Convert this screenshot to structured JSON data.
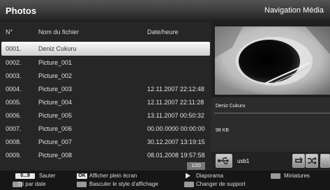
{
  "header": {
    "title": "Photos",
    "right_label": "Navigation Média"
  },
  "list": {
    "columns": {
      "number": "N°",
      "filename": "Nom du fichier",
      "datetime": "Date/heure"
    },
    "rows": [
      {
        "number": "0001.",
        "name": "Deniz Cukuru",
        "date": "",
        "selected": true
      },
      {
        "number": "0002.",
        "name": "Picture_001",
        "date": ""
      },
      {
        "number": "0003.",
        "name": "Picture_002",
        "date": ""
      },
      {
        "number": "0004.",
        "name": "Picture_003",
        "date": "12.11.2007 22:12:48"
      },
      {
        "number": "0005.",
        "name": "Picture_004",
        "date": "12.11.2007 22:11:28"
      },
      {
        "number": "0006.",
        "name": "Picture_005",
        "date": "13.11.2007 00:50:32"
      },
      {
        "number": "0007.",
        "name": "Picture_006",
        "date": "00.00.0000 00:00:00"
      },
      {
        "number": "0008.",
        "name": "Picture_007",
        "date": "30.12.2007 13:19:15"
      },
      {
        "number": "0009.",
        "name": "Picture_008",
        "date": "08.01.2008 19:57:58"
      }
    ],
    "page": "1/20"
  },
  "preview": {
    "image_icon": "photo-thumbnail-icon",
    "file_name": "Deniz Cukuru",
    "file_size": "98 KB",
    "source_label": "usb1",
    "source_icon": "usb-icon",
    "repeat_icon": "repeat-icon",
    "shuffle_icon": "shuffle-icon"
  },
  "footer": {
    "keys": {
      "jump_key": "0...9",
      "jump_label": "Sauter",
      "ok_key": "OK",
      "ok_label": "Afficher plein écran",
      "play_label": "Diaporama",
      "thumbs_label": "Miniatures",
      "sort_label": "Tri par date",
      "style_label": "Basculer le style d'affichage",
      "source_label": "Changer de support"
    },
    "colors": {
      "red": "#c0392b",
      "yellow": "#d7c94a",
      "blue": "#2a5db0",
      "green": "#3b9a3b",
      "white_key": "#e8e8e8"
    }
  },
  "colors": {
    "selected_row": "#e8e8e8",
    "background": "#262626",
    "header": "#3d3d3d"
  }
}
